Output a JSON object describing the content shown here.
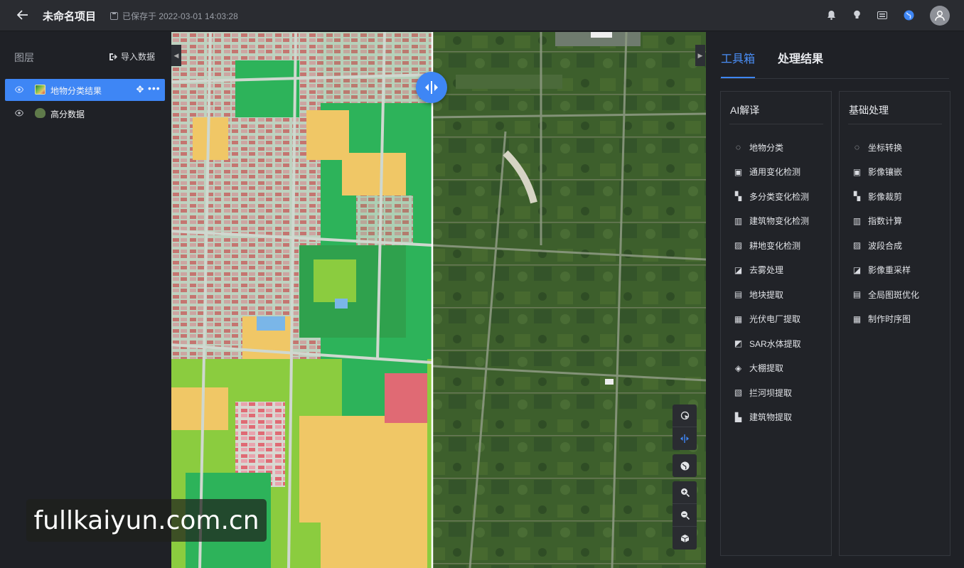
{
  "header": {
    "back_icon": "arrow-left-icon",
    "project_title": "未命名项目",
    "saved_text": "已保存于 2022-03-01 14:03:28",
    "icons": [
      "bell-icon",
      "lightbulb-icon",
      "keyboard-icon",
      "globe-icon",
      "user-avatar-icon"
    ]
  },
  "layers_panel": {
    "title": "图层",
    "import_label": "导入数据",
    "layers": [
      {
        "name": "地物分类结果",
        "active": true
      },
      {
        "name": "高分数据",
        "active": false
      }
    ]
  },
  "map": {
    "split_handle_icon": "split-compare-icon",
    "tools": [
      "pointer-icon",
      "split-icon",
      "globe-icon",
      "zoom-in-icon",
      "zoom-out-icon",
      "3d-cube-icon"
    ]
  },
  "watermark": "fullkaiyun.com.cn",
  "toolbox": {
    "tabs": [
      "工具箱",
      "处理结果"
    ],
    "ai_column": {
      "title": "AI解译",
      "items": [
        "地物分类",
        "通用变化检测",
        "多分类变化检测",
        "建筑物变化检测",
        "耕地变化检测",
        "去雾处理",
        "地块提取",
        "光伏电厂提取",
        "SAR水体提取",
        "大棚提取",
        "拦河坝提取",
        "建筑物提取"
      ]
    },
    "basic_column": {
      "title": "基础处理",
      "items": [
        "坐标转换",
        "影像镶嵌",
        "影像裁剪",
        "指数计算",
        "波段合成",
        "影像重采样",
        "全局图斑优化",
        "制作时序图"
      ]
    }
  },
  "colors": {
    "accent": "#3e86f5",
    "background": "#1f2126",
    "topbar": "#2a2c31"
  }
}
